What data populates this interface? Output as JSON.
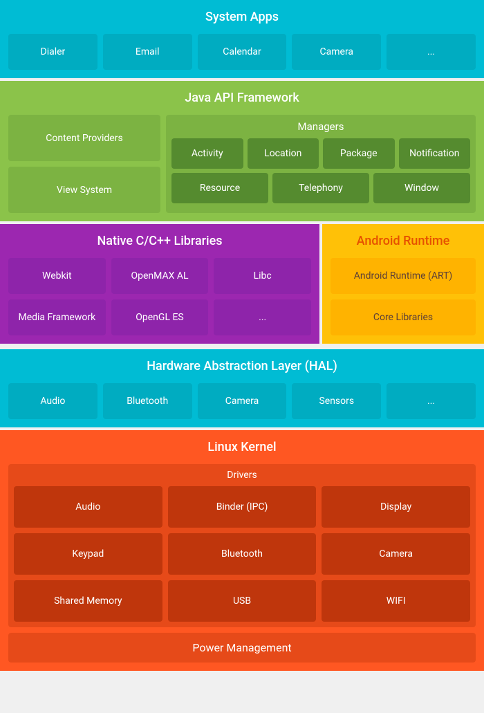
{
  "system_apps": {
    "title": "System Apps",
    "items": [
      "Dialer",
      "Email",
      "Calendar",
      "Camera",
      "..."
    ]
  },
  "java_api": {
    "title": "Java API Framework",
    "content_providers": "Content Providers",
    "view_system": "View System",
    "managers_title": "Managers",
    "manager_row1": [
      "Activity",
      "Location",
      "Package",
      "Notification"
    ],
    "manager_row2": [
      "Resource",
      "Telephony",
      "Window"
    ]
  },
  "native_libs": {
    "title": "Native C/C++ Libraries",
    "row1": [
      "Webkit",
      "OpenMAX AL",
      "Libc"
    ],
    "row2": [
      "Media Framework",
      "OpenGL ES",
      "..."
    ]
  },
  "android_runtime": {
    "title": "Android Runtime",
    "items": [
      "Android Runtime (ART)",
      "Core Libraries"
    ]
  },
  "hal": {
    "title": "Hardware Abstraction Layer (HAL)",
    "items": [
      "Audio",
      "Bluetooth",
      "Camera",
      "Sensors",
      "..."
    ]
  },
  "linux_kernel": {
    "title": "Linux Kernel",
    "drivers_title": "Drivers",
    "driver_row1": [
      "Audio",
      "Binder (IPC)",
      "Display"
    ],
    "driver_row2": [
      "Keypad",
      "Bluetooth",
      "Camera"
    ],
    "driver_row3": [
      "Shared Memory",
      "USB",
      "WIFI"
    ],
    "power_management": "Power Management"
  }
}
